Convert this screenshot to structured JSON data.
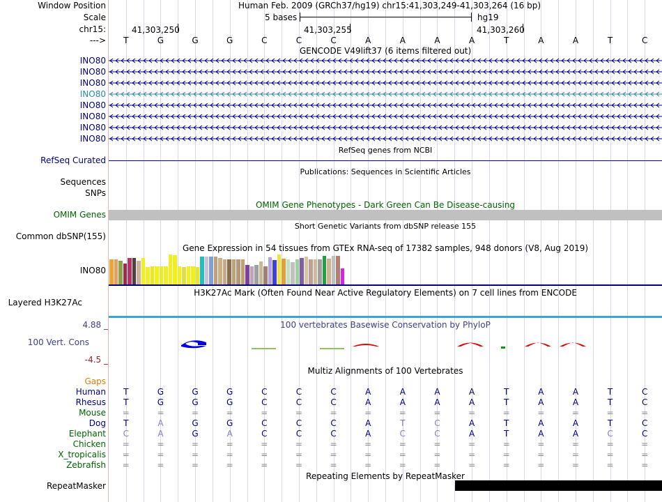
{
  "header": {
    "window_position_label": "Window Position",
    "scale_label": "Scale",
    "chr_label": "chr15:",
    "arrow_label": "--->",
    "title": "Human Feb. 2009 (GRCh37/hg19)   chr15:41,303,249-41,303,264 (16 bp)",
    "scale_text": "5 bases",
    "assembly": "hg19",
    "positions": [
      "41,303,250",
      "41,303,255",
      "41,303,260"
    ],
    "bases": [
      "T",
      "G",
      "G",
      "G",
      "C",
      "C",
      "C",
      "A",
      "A",
      "A",
      "A",
      "T",
      "A",
      "A",
      "T",
      "C"
    ]
  },
  "gencode": {
    "title": "GENCODE V49lift37 (6 items filtered out)",
    "transcripts": [
      "INO80",
      "INO80",
      "INO80",
      "INO80",
      "INO80",
      "INO80",
      "INO80",
      "INO80"
    ]
  },
  "refseq": {
    "title": "RefSeq genes from NCBI",
    "label": "RefSeq Curated"
  },
  "publications": {
    "title": "Publications: Sequences in Scientific Articles",
    "label1": "Sequences",
    "label2": "SNPs"
  },
  "omim": {
    "title": "OMIM Gene Phenotypes - Dark Green Can Be Disease-causing",
    "label": "OMIM Genes"
  },
  "dbsnp": {
    "title": "Short Genetic Variants from dbSNP release 155",
    "label": "Common dbSNP(155)"
  },
  "gtex": {
    "title": "Gene Expression in 54 tissues from GTEx RNA-seq of 17382 samples, 948 donors (V8, Aug 2019)",
    "label": "INO80",
    "bar_levels": [
      0.82,
      0.82,
      0.78,
      0.68,
      0.86,
      0.86,
      0.78,
      0.86,
      0.56,
      0.58,
      0.6,
      0.58,
      0.6,
      0.98,
      0.96,
      0.6,
      0.56,
      0.6,
      0.6,
      0.56,
      0.9,
      0.92,
      0.92,
      0.9,
      0.86,
      0.82,
      0.82,
      0.82,
      0.82,
      0.82,
      0.64,
      0.6,
      0.64,
      0.76,
      0.6,
      0.88,
      0.8,
      0.98,
      0.84,
      0.82,
      0.72,
      0.82,
      0.86,
      0.9,
      0.82,
      0.82,
      0.82,
      0.94,
      0.84,
      0.94,
      0.94,
      0.52
    ],
    "bar_colors": [
      "#f5a330",
      "#e8a060",
      "#8fa050",
      "#9c2a48",
      "#c03060",
      "#504040",
      "#d0b0a0",
      "#f0f020",
      "#f0f020",
      "#e8e820",
      "#f0f020",
      "#eaea30",
      "#f0f020",
      "#f0f020",
      "#f0f020",
      "#f0f020",
      "#e0e040",
      "#f0f020",
      "#f0f020",
      "#e8e820",
      "#20c0c0",
      "#d0c0d8",
      "#80a0d0",
      "#c0a080",
      "#d0b080",
      "#c8a888",
      "#8c6c4c",
      "#c0a078",
      "#b89878",
      "#c0a070",
      "#8040a0",
      "#c0a0c0",
      "#a0a0a0",
      "#c8b898",
      "#a08070",
      "#b0a0f0",
      "#4040e0",
      "#f0e040",
      "#e0a040",
      "#c0e0c0",
      "#c0c0c0",
      "#a0d0a0",
      "#8060a0",
      "#e0c0a0",
      "#c0a090",
      "#d0b8a0",
      "#a0a0a0",
      "#20a040",
      "#d0b090",
      "#c0c0c0",
      "#b08070",
      "#e020e0"
    ]
  },
  "h3k27ac": {
    "title": "H3K27Ac Mark (Often Found Near Active Regulatory Elements) on 7 cell lines from ENCODE",
    "label": "Layered H3K27Ac"
  },
  "phylop": {
    "title": "100 vertebrates Basewise Conservation by PhyloP",
    "label": "100 Vert. Cons",
    "max": "4.88 _",
    "min": "-4.5 _"
  },
  "multiz": {
    "title": "Multiz Alignments of 100 Vertebrates",
    "gaps_label": "Gaps",
    "species": [
      {
        "name": "Human",
        "seq": [
          "T",
          "G",
          "G",
          "G",
          "C",
          "C",
          "C",
          "A",
          "A",
          "A",
          "A",
          "T",
          "A",
          "A",
          "T",
          "C"
        ]
      },
      {
        "name": "Rhesus",
        "seq": [
          "T",
          "G",
          "G",
          "G",
          "C",
          "C",
          "C",
          "A",
          "A",
          "A",
          "A",
          "T",
          "A",
          "A",
          "T",
          "C"
        ]
      },
      {
        "name": "Mouse",
        "seq": [
          "=",
          "=",
          "=",
          "=",
          "=",
          "=",
          "=",
          "=",
          "=",
          "=",
          "=",
          "=",
          "=",
          "=",
          "=",
          "="
        ]
      },
      {
        "name": "Dog",
        "seq": [
          "T",
          "A",
          "G",
          "G",
          "C",
          "C",
          "C",
          "A",
          "T",
          "C",
          "A",
          "T",
          "A",
          "A",
          "T",
          "C"
        ]
      },
      {
        "name": "Elephant",
        "seq": [
          "C",
          "A",
          "G",
          "A",
          "C",
          "C",
          "C",
          "A",
          "C",
          "C",
          "A",
          "T",
          "A",
          "A",
          "C",
          "C"
        ]
      },
      {
        "name": "Chicken",
        "seq": [
          "=",
          "=",
          "=",
          "=",
          "=",
          "=",
          "=",
          "=",
          "=",
          "=",
          "=",
          "=",
          "=",
          "=",
          "=",
          "="
        ]
      },
      {
        "name": "X_tropicalis",
        "seq": [
          "=",
          "=",
          "=",
          "=",
          "=",
          "=",
          "=",
          "=",
          "=",
          "=",
          "=",
          "=",
          "=",
          "=",
          "=",
          "="
        ]
      },
      {
        "name": "Zebrafish",
        "seq": [
          "=",
          "=",
          "=",
          "=",
          "=",
          "=",
          "=",
          "=",
          "=",
          "=",
          "=",
          "=",
          "=",
          "=",
          "=",
          "="
        ]
      }
    ]
  },
  "repeatmasker": {
    "title": "Repeating Elements by RepeatMasker",
    "label": "RepeatMasker"
  },
  "colors": {
    "navy": "#000080",
    "omim_bar": "#c0c0c0",
    "omim_text": "#006400",
    "h3k27ac_line": "#3da0e0",
    "phylop_text": "#404090",
    "phylop_max": "#404090",
    "phylop_min": "#a02020"
  }
}
